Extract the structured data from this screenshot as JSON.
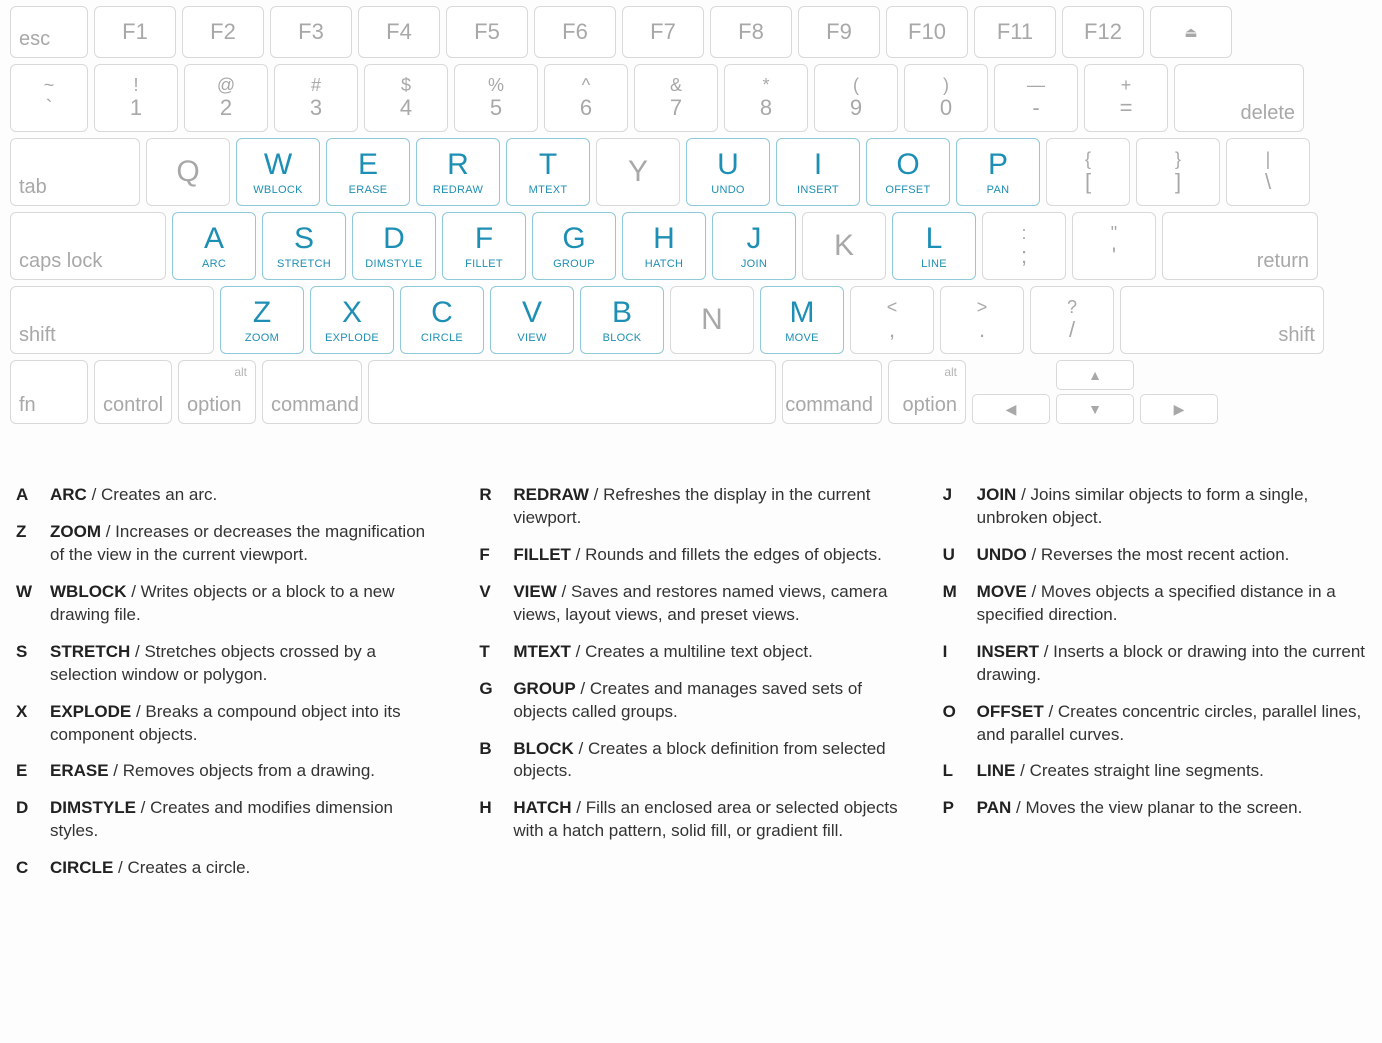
{
  "row0": {
    "esc": "esc",
    "fkeys": [
      "F1",
      "F2",
      "F3",
      "F4",
      "F5",
      "F6",
      "F7",
      "F8",
      "F9",
      "F10",
      "F11",
      "F12"
    ],
    "eject": "⏏"
  },
  "row1": {
    "pairs": [
      [
        "~",
        "`"
      ],
      [
        "!",
        "1"
      ],
      [
        "@",
        "2"
      ],
      [
        "#",
        "3"
      ],
      [
        "$",
        "4"
      ],
      [
        "%",
        "5"
      ],
      [
        "^",
        "6"
      ],
      [
        "&",
        "7"
      ],
      [
        "*",
        "8"
      ],
      [
        "(",
        "9"
      ],
      [
        ")",
        "0"
      ],
      [
        "—",
        "-"
      ],
      [
        "+",
        "="
      ]
    ],
    "delete": "delete"
  },
  "row2": {
    "tab": "tab",
    "keys": [
      {
        "l": "Q"
      },
      {
        "l": "W",
        "c": "WBLOCK"
      },
      {
        "l": "E",
        "c": "ERASE"
      },
      {
        "l": "R",
        "c": "REDRAW"
      },
      {
        "l": "T",
        "c": "MTEXT"
      },
      {
        "l": "Y"
      },
      {
        "l": "U",
        "c": "UNDO"
      },
      {
        "l": "I",
        "c": "INSERT"
      },
      {
        "l": "O",
        "c": "OFFSET"
      },
      {
        "l": "P",
        "c": "PAN"
      }
    ],
    "brackets": [
      [
        "{",
        "["
      ],
      [
        "}",
        "]"
      ],
      [
        "|",
        "\\"
      ]
    ]
  },
  "row3": {
    "caps": "caps lock",
    "keys": [
      {
        "l": "A",
        "c": "ARC"
      },
      {
        "l": "S",
        "c": "STRETCH"
      },
      {
        "l": "D",
        "c": "DIMSTYLE"
      },
      {
        "l": "F",
        "c": "FILLET"
      },
      {
        "l": "G",
        "c": "GROUP"
      },
      {
        "l": "H",
        "c": "HATCH"
      },
      {
        "l": "J",
        "c": "JOIN"
      },
      {
        "l": "K"
      },
      {
        "l": "L",
        "c": "LINE"
      }
    ],
    "punct": [
      [
        ":",
        ";"
      ],
      [
        "\"",
        "'"
      ]
    ],
    "return": "return"
  },
  "row4": {
    "shift": "shift",
    "keys": [
      {
        "l": "Z",
        "c": "ZOOM"
      },
      {
        "l": "X",
        "c": "EXPLODE"
      },
      {
        "l": "C",
        "c": "CIRCLE"
      },
      {
        "l": "V",
        "c": "VIEW"
      },
      {
        "l": "B",
        "c": "BLOCK"
      },
      {
        "l": "N"
      },
      {
        "l": "M",
        "c": "MOVE"
      }
    ],
    "punct": [
      [
        "<",
        ","
      ],
      [
        ">",
        "."
      ],
      [
        "?",
        "/"
      ]
    ],
    "shiftr": "shift"
  },
  "row5": {
    "fn": "fn",
    "control": "control",
    "alt": "alt",
    "option": "option",
    "command": "command"
  },
  "arrows": {
    "up": "▲",
    "down": "▼",
    "left": "◀",
    "right": "▶"
  },
  "legend": {
    "col1": [
      {
        "k": "A",
        "cmd": "ARC",
        "desc": "Creates an arc."
      },
      {
        "k": "Z",
        "cmd": "ZOOM",
        "desc": "Increases or decreases the magnification of the view in the current viewport."
      },
      {
        "k": "W",
        "cmd": "WBLOCK",
        "desc": "Writes objects or a block to a new drawing file."
      },
      {
        "k": "S",
        "cmd": "STRETCH",
        "desc": "Stretches objects crossed by a selection window or polygon."
      },
      {
        "k": "X",
        "cmd": "EXPLODE",
        "desc": "Breaks a compound object into its component objects."
      },
      {
        "k": "E",
        "cmd": "ERASE",
        "desc": "Removes objects from a drawing."
      },
      {
        "k": "D",
        "cmd": "DIMSTYLE",
        "desc": "Creates and modifies dimension styles."
      },
      {
        "k": "C",
        "cmd": "CIRCLE",
        "desc": "Creates a circle."
      }
    ],
    "col2": [
      {
        "k": "R",
        "cmd": "REDRAW",
        "desc": "Refreshes the display in the current viewport."
      },
      {
        "k": "F",
        "cmd": "FILLET",
        "desc": "Rounds and fillets the edges of objects."
      },
      {
        "k": "V",
        "cmd": "VIEW",
        "desc": "Saves and restores named views, camera views, layout views, and preset views."
      },
      {
        "k": "T",
        "cmd": "MTEXT",
        "desc": "Creates a multiline text object."
      },
      {
        "k": "G",
        "cmd": "GROUP",
        "desc": "Creates and manages saved sets of objects called groups."
      },
      {
        "k": "B",
        "cmd": "BLOCK",
        "desc": "Creates a block definition from selected objects."
      },
      {
        "k": "H",
        "cmd": "HATCH",
        "desc": "Fills an enclosed area or selected objects with a hatch pattern, solid fill, or gradient fill."
      }
    ],
    "col3": [
      {
        "k": "J",
        "cmd": "JOIN",
        "desc": "Joins similar objects to form a single, unbroken object."
      },
      {
        "k": "U",
        "cmd": "UNDO",
        "desc": "Reverses the most recent action."
      },
      {
        "k": "M",
        "cmd": "MOVE",
        "desc": "Moves objects a specified distance in a specified direction."
      },
      {
        "k": "I",
        "cmd": "INSERT",
        "desc": "Inserts a block or drawing into the current drawing."
      },
      {
        "k": "O",
        "cmd": "OFFSET",
        "desc": "Creates concentric circles, parallel lines, and parallel curves."
      },
      {
        "k": "L",
        "cmd": "LINE",
        "desc": "Creates straight line segments."
      },
      {
        "k": "P",
        "cmd": "PAN",
        "desc": "Moves the view planar to the screen."
      }
    ]
  }
}
